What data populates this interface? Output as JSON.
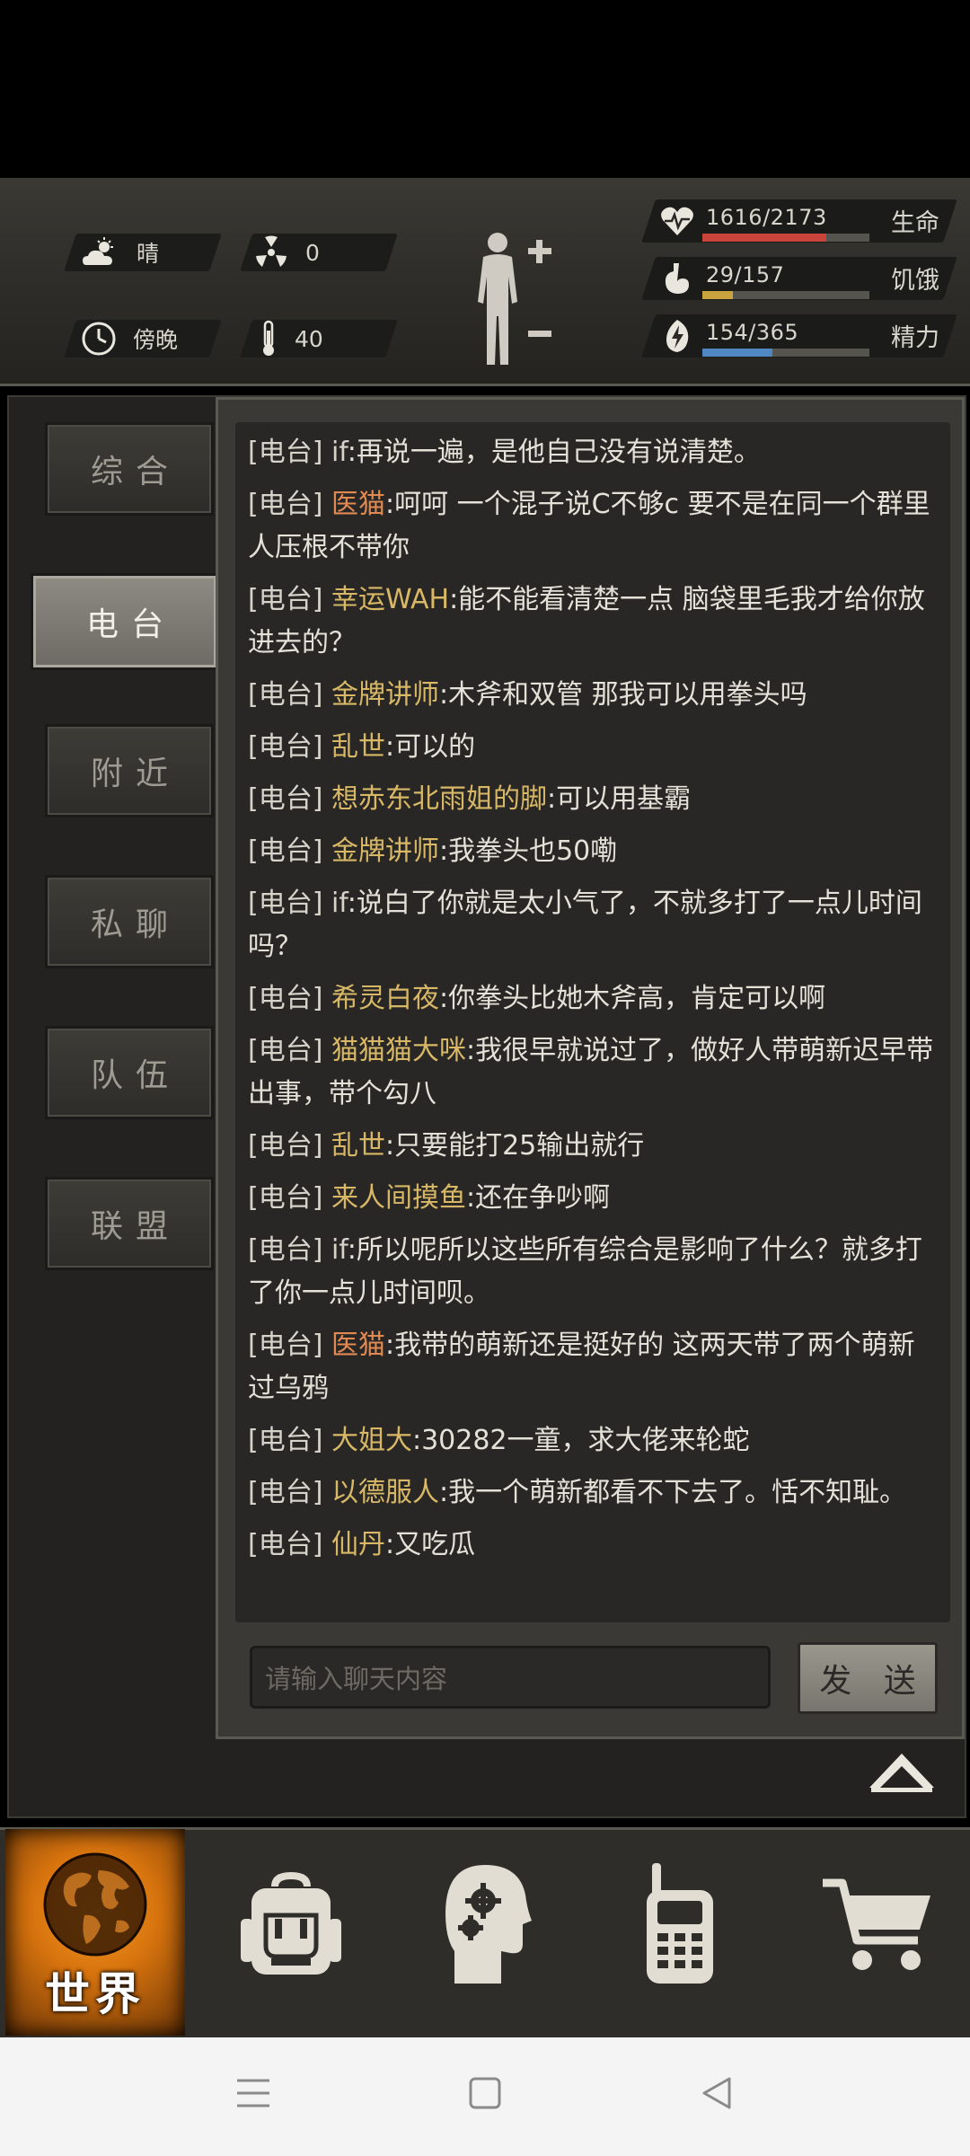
{
  "status": {
    "weather": "晴",
    "radiation": "0",
    "time_of_day": "傍晚",
    "temperature": "40",
    "health": {
      "text": "1616/2173",
      "label": "生命",
      "fraction": 0.744,
      "color": "#c9453c"
    },
    "hunger": {
      "text": "29/157",
      "label": "饥饿",
      "fraction": 0.185,
      "color": "#c9a43e"
    },
    "energy": {
      "text": "154/365",
      "label": "精力",
      "fraction": 0.422,
      "color": "#4f87c2"
    }
  },
  "tabs": [
    {
      "label": "综合",
      "active": false
    },
    {
      "label": "电台",
      "active": true
    },
    {
      "label": "附近",
      "active": false
    },
    {
      "label": "私聊",
      "active": false
    },
    {
      "label": "队伍",
      "active": false
    },
    {
      "label": "联盟",
      "active": false
    }
  ],
  "messages": [
    {
      "tag": "[电台]",
      "name": "if",
      "style": "plain",
      "text": ":再说一遍，是他自己没有说清楚。"
    },
    {
      "tag": "[电台]",
      "name": "医猫",
      "style": "orange",
      "text": ":呵呵 一个混子说C不够c 要不是在同一个群里人压根不带你"
    },
    {
      "tag": "[电台]",
      "name": "幸运WAH",
      "style": "gold",
      "text": ":能不能看清楚一点 脑袋里毛我才给你放进去的？"
    },
    {
      "tag": "[电台]",
      "name": "金牌讲师",
      "style": "gold",
      "text": ":木斧和双管 那我可以用拳头吗"
    },
    {
      "tag": "[电台]",
      "name": "乱世",
      "style": "gold",
      "text": ":可以的"
    },
    {
      "tag": "[电台]",
      "name": "想赤东北雨姐的脚",
      "style": "gold",
      "text": ":可以用基霸"
    },
    {
      "tag": "[电台]",
      "name": "金牌讲师",
      "style": "gold",
      "text": ":我拳头也50嘞"
    },
    {
      "tag": "[电台]",
      "name": "if",
      "style": "plain",
      "text": ":说白了你就是太小气了，不就多打了一点儿时间吗？"
    },
    {
      "tag": "[电台]",
      "name": "希灵白夜",
      "style": "gold",
      "text": ":你拳头比她木斧高，肯定可以啊"
    },
    {
      "tag": "[电台]",
      "name": "猫猫猫大咪",
      "style": "gold",
      "text": ":我很早就说过了，做好人带萌新迟早带出事，带个勾八"
    },
    {
      "tag": "[电台]",
      "name": "乱世",
      "style": "gold",
      "text": ":只要能打25输出就行"
    },
    {
      "tag": "[电台]",
      "name": "来人间摸鱼",
      "style": "gold",
      "text": ":还在争吵啊"
    },
    {
      "tag": "[电台]",
      "name": "if",
      "style": "plain",
      "text": ":所以呢所以这些所有综合是影响了什么？就多打了你一点儿时间呗。"
    },
    {
      "tag": "[电台]",
      "name": "医猫",
      "style": "orange",
      "text": ":我带的萌新还是挺好的 这两天带了两个萌新过乌鸦"
    },
    {
      "tag": "[电台]",
      "name": "大姐大",
      "style": "gold",
      "text": ":30282一童，求大佬来轮蛇"
    },
    {
      "tag": "[电台]",
      "name": "以德服人",
      "style": "gold",
      "text": ":我一个萌新都看不下去了。恬不知耻。"
    },
    {
      "tag": "[电台]",
      "name": "仙丹",
      "style": "gold",
      "text": ":又吃瓜"
    }
  ],
  "chat_input": {
    "placeholder": "请输入聊天内容"
  },
  "send_button": "发 送",
  "bottom_nav": {
    "world_label": "世界"
  },
  "icons": [
    "sun-cloud-icon",
    "radiation-icon",
    "clock-icon",
    "thermometer-icon",
    "body-figure-icon",
    "heart-icon",
    "stomach-icon",
    "energy-icon",
    "collapse-up-icon",
    "globe-icon",
    "backpack-icon",
    "head-gears-icon",
    "walkie-talkie-icon",
    "cart-icon",
    "menu-icon",
    "home-icon",
    "back-icon"
  ]
}
